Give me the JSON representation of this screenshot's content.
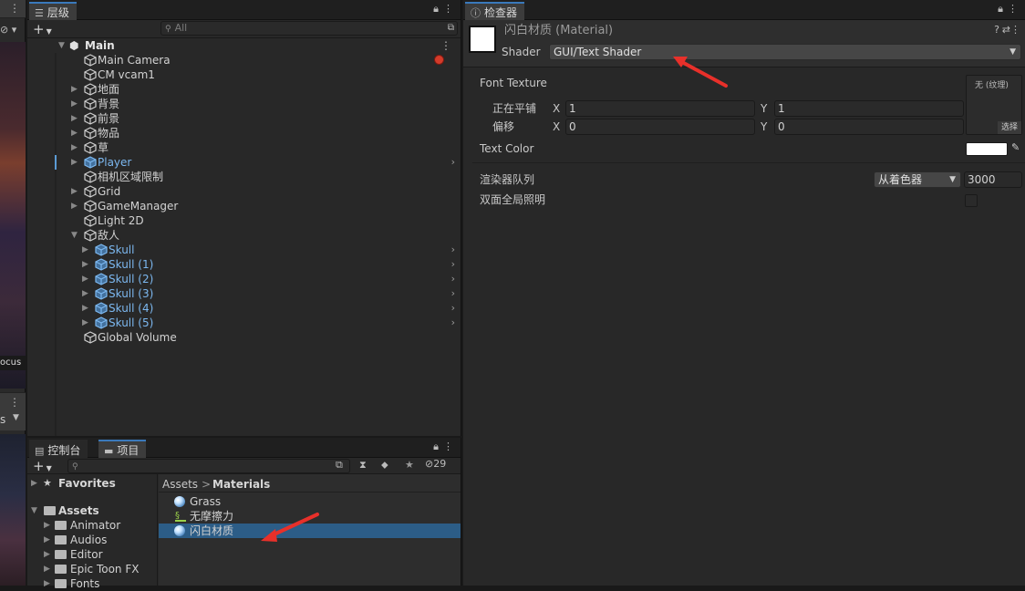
{
  "scene_sliver": {
    "focus_text": "ocus",
    "s_text": "s"
  },
  "hierarchy": {
    "tab_label": "层级",
    "search_placeholder": "All",
    "scene_name": "Main",
    "items": [
      {
        "label": "Main Camera",
        "indent": 1,
        "expand": false,
        "prefab": false,
        "badge": true
      },
      {
        "label": "CM vcam1",
        "indent": 1,
        "expand": false,
        "prefab": false
      },
      {
        "label": "地面",
        "indent": 1,
        "expand": true,
        "prefab": false
      },
      {
        "label": "背景",
        "indent": 1,
        "expand": true,
        "prefab": false
      },
      {
        "label": "前景",
        "indent": 1,
        "expand": true,
        "prefab": false
      },
      {
        "label": "物品",
        "indent": 1,
        "expand": true,
        "prefab": false
      },
      {
        "label": "草",
        "indent": 1,
        "expand": true,
        "prefab": false
      },
      {
        "label": "Player",
        "indent": 1,
        "expand": true,
        "prefab": true,
        "chevron": true,
        "marked": true
      },
      {
        "label": "相机区域限制",
        "indent": 1,
        "expand": false,
        "prefab": false
      },
      {
        "label": "Grid",
        "indent": 1,
        "expand": true,
        "prefab": false
      },
      {
        "label": "GameManager",
        "indent": 1,
        "expand": true,
        "prefab": false
      },
      {
        "label": "Light 2D",
        "indent": 1,
        "expand": false,
        "prefab": false
      },
      {
        "label": "敌人",
        "indent": 1,
        "expand": "open",
        "prefab": false
      },
      {
        "label": "Skull",
        "indent": 2,
        "expand": true,
        "prefab": true,
        "chevron": true
      },
      {
        "label": "Skull (1)",
        "indent": 2,
        "expand": true,
        "prefab": true,
        "chevron": true
      },
      {
        "label": "Skull (2)",
        "indent": 2,
        "expand": true,
        "prefab": true,
        "chevron": true
      },
      {
        "label": "Skull (3)",
        "indent": 2,
        "expand": true,
        "prefab": true,
        "chevron": true
      },
      {
        "label": "Skull (4)",
        "indent": 2,
        "expand": true,
        "prefab": true,
        "chevron": true
      },
      {
        "label": "Skull (5)",
        "indent": 2,
        "expand": true,
        "prefab": true,
        "chevron": true
      },
      {
        "label": "Global Volume",
        "indent": 1,
        "expand": false,
        "prefab": false
      }
    ]
  },
  "project": {
    "tab_console": "控制台",
    "tab_project": "项目",
    "hidden_count": "29",
    "favorites": "Favorites",
    "assets": "Assets",
    "folders": [
      "Animator",
      "Audios",
      "Editor",
      "Epic Toon FX",
      "Fonts"
    ],
    "breadcrumb": {
      "root": "Assets",
      "sep": ">",
      "current": "Materials"
    },
    "files": [
      {
        "label": "Grass",
        "icon": "material-sphere-icon"
      },
      {
        "label": "无摩擦力",
        "icon": "physics-material-icon"
      },
      {
        "label": "闪白材质",
        "icon": "material-sphere-icon",
        "selected": true
      }
    ]
  },
  "inspector": {
    "tab_label": "检查器",
    "material_name": "闪白材质 (Material)",
    "shader_label": "Shader",
    "shader_value": "GUI/Text Shader",
    "font_texture_label": "Font Texture",
    "tiling_label": "正在平铺",
    "offset_label": "偏移",
    "x_label": "X",
    "y_label": "Y",
    "tiling_x": "1",
    "tiling_y": "1",
    "offset_x": "0",
    "offset_y": "0",
    "texture_none": "无 (纹理)",
    "select_label": "选择",
    "text_color_label": "Text Color",
    "render_queue_label": "渲染器队列",
    "render_queue_mode": "从着色器",
    "render_queue_value": "3000",
    "double_sided_gi_label": "双面全局照明"
  },
  "colors": {
    "accent": "#3a79bb",
    "prefab": "#7cb8f0",
    "selection": "#2c5d87",
    "annotation_arrow": "#e8302a"
  }
}
